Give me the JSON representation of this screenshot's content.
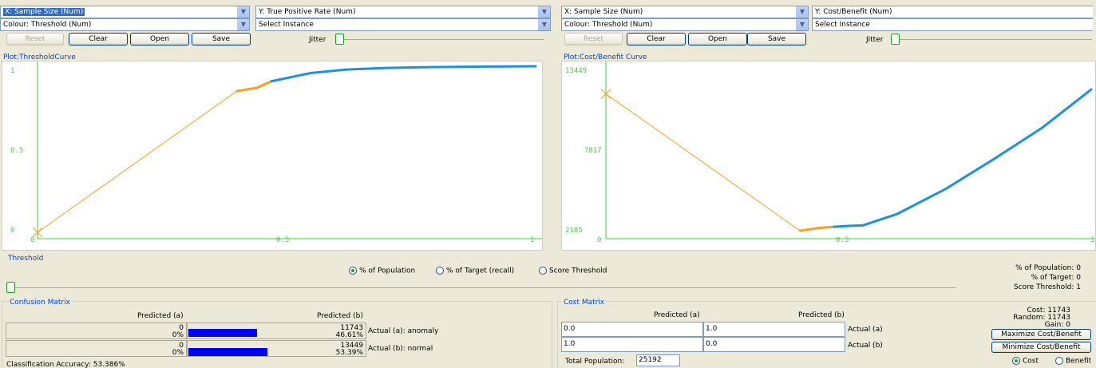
{
  "left": {
    "x_axis": "X: Sample Size (Num)",
    "y_axis": "Y: True Positive Rate (Num)",
    "colour": "Colour: Threshold (Num)",
    "select_instance": "Select Instance",
    "buttons": {
      "reset": "Reset",
      "clear": "Clear",
      "open": "Open",
      "save": "Save"
    },
    "jitter": "Jitter",
    "plot_title": "Plot:ThresholdCurve",
    "y_ticks": [
      "1",
      "0.5",
      "0"
    ],
    "x_ticks": [
      "0",
      "0.5",
      "1"
    ]
  },
  "right": {
    "x_axis": "X: Sample Size (Num)",
    "y_axis": "Y: Cost/Benefit (Num)",
    "colour": "Colour: Threshold (Num)",
    "select_instance": "Select Instance",
    "buttons": {
      "reset": "Reset",
      "clear": "Clear",
      "open": "Open",
      "save": "Save"
    },
    "jitter": "Jitter",
    "plot_title": "Plot:Cost/Benefit Curve",
    "y_ticks": [
      "13449",
      "7817",
      "2185"
    ],
    "x_ticks": [
      "0",
      "0.5",
      "1"
    ]
  },
  "chart_data": [
    {
      "type": "line",
      "title": "Plot:ThresholdCurve",
      "xlabel": "X: Sample Size (Num)",
      "ylabel": "Y: True Positive Rate (Num)",
      "xlim": [
        0,
        1
      ],
      "ylim": [
        0,
        1
      ],
      "x": [
        0,
        0.4,
        0.44,
        0.47,
        0.55,
        0.62,
        0.7,
        0.8,
        0.9,
        1.0
      ],
      "y": [
        0,
        0.85,
        0.87,
        0.91,
        0.96,
        0.98,
        0.99,
        0.995,
        0.998,
        1.0
      ]
    },
    {
      "type": "line",
      "title": "Plot:Cost/Benefit Curve",
      "xlabel": "X: Sample Size (Num)",
      "ylabel": "Y: Cost/Benefit (Num)",
      "xlim": [
        0,
        1
      ],
      "ylim": [
        2185,
        13449
      ],
      "x": [
        0,
        0.4,
        0.44,
        0.47,
        0.5,
        0.53,
        0.6,
        0.7,
        0.8,
        0.9,
        1.0
      ],
      "y": [
        11743,
        2185,
        2380,
        2460,
        2520,
        2560,
        3350,
        5100,
        7200,
        9400,
        12050
      ]
    }
  ],
  "threshold": {
    "title": "Threshold",
    "options": [
      "% of Population",
      "% of Target (recall)",
      "Score Threshold"
    ],
    "selected": "% of Population",
    "stats": [
      "% of Population: 0",
      "% of Target: 0",
      "Score Threshold: 1"
    ],
    "slider_value": 0
  },
  "confusion": {
    "title": "Confusion Matrix",
    "col_a": "Predicted (a)",
    "col_b": "Predicted (b)",
    "rows": [
      {
        "a_count": "0",
        "a_pct": "0%",
        "b_count": "11743",
        "b_pct": "46.61%",
        "label": "Actual (a): anomaly",
        "bar_fraction": 0.4661
      },
      {
        "a_count": "0",
        "a_pct": "0%",
        "b_count": "13449",
        "b_pct": "53.39%",
        "label": "Actual (b): normal",
        "bar_fraction": 0.5339
      }
    ],
    "accuracy": "Classification Accuracy:  53.386%"
  },
  "cost": {
    "title": "Cost Matrix",
    "col_a": "Predicted (a)",
    "col_b": "Predicted (b)",
    "rows": [
      {
        "a": "0.0",
        "b": "1.0",
        "label": "Actual (a)"
      },
      {
        "a": "1.0",
        "b": "0.0",
        "label": "Actual (b)"
      }
    ],
    "total_label": "Total Population:",
    "total_value": "25192",
    "stats": [
      "Cost: 11743",
      "Random: 11743",
      "Gain: 0"
    ],
    "maximize": "Maximize Cost/Benefit",
    "minimize": "Minimize Cost/Benefit",
    "radio_cost": "Cost",
    "radio_benefit": "Benefit",
    "selected": "Cost"
  },
  "colors": {
    "low": "#f7a020",
    "high": "#1e90e0",
    "axis": "#3ccf3c",
    "accent": "#0046d5",
    "bar": "#0000ee"
  }
}
